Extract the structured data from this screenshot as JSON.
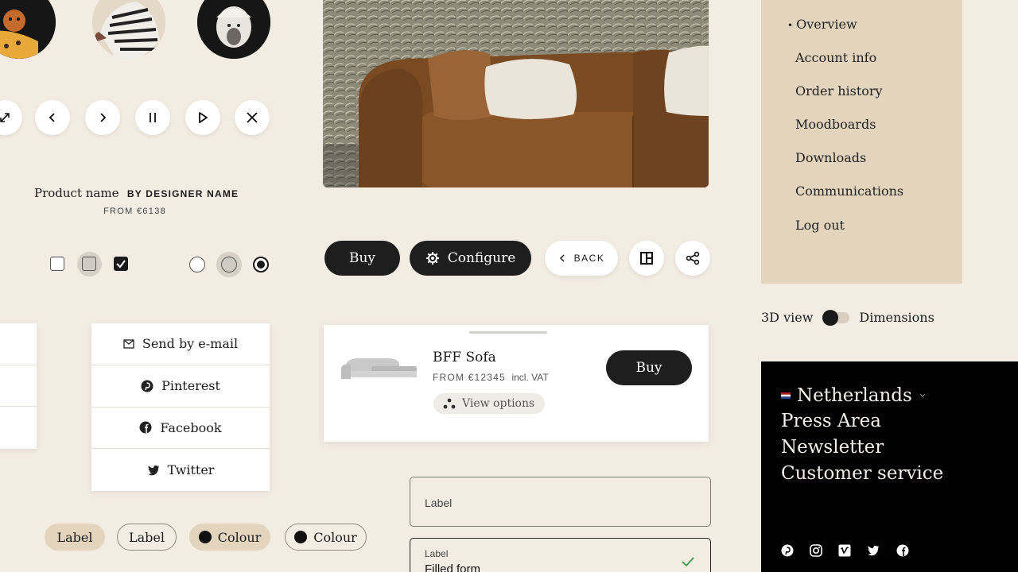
{
  "product": {
    "name": "Product name",
    "designer": "BY DESIGNER NAME",
    "price": "FROM €6138"
  },
  "actions": {
    "buy_label": "Buy",
    "configure_label": "Configure",
    "back_label": "BACK"
  },
  "share": {
    "items": [
      {
        "label": "Send by e-mail",
        "icon": "mail-icon"
      },
      {
        "label": "Pinterest",
        "icon": "pinterest-icon"
      },
      {
        "label": "Facebook",
        "icon": "facebook-icon"
      },
      {
        "label": "Twitter",
        "icon": "twitter-icon"
      }
    ]
  },
  "chips": [
    {
      "label": "Label",
      "style": "filled"
    },
    {
      "label": "Label",
      "style": "outlined"
    },
    {
      "label": "Colour",
      "style": "filled"
    },
    {
      "label": "Colour",
      "style": "outlined"
    }
  ],
  "product_card": {
    "title": "BFF Sofa",
    "price": "FROM €12345",
    "vat": "incl. VAT",
    "view_options": "View options",
    "buy_label": "Buy"
  },
  "form": {
    "empty_placeholder": "Label",
    "filled_label": "Label",
    "filled_value": "Filled form"
  },
  "account_menu": {
    "items": [
      {
        "label": "Overview",
        "active": true
      },
      {
        "label": "Account info"
      },
      {
        "label": "Order history"
      },
      {
        "label": "Moodboards"
      },
      {
        "label": "Downloads"
      },
      {
        "label": "Communications"
      },
      {
        "label": "Log out"
      }
    ]
  },
  "view_toggle": {
    "left_label": "3D view",
    "right_label": "Dimensions"
  },
  "footer": {
    "country": "Netherlands",
    "links": [
      "Press Area",
      "Newsletter",
      "Customer service"
    ]
  },
  "colors": {
    "background": "#f3ece3",
    "accent_beige": "#e2d4bd",
    "dark": "#1e1e1e",
    "valid_check": "#3d9a4a"
  }
}
